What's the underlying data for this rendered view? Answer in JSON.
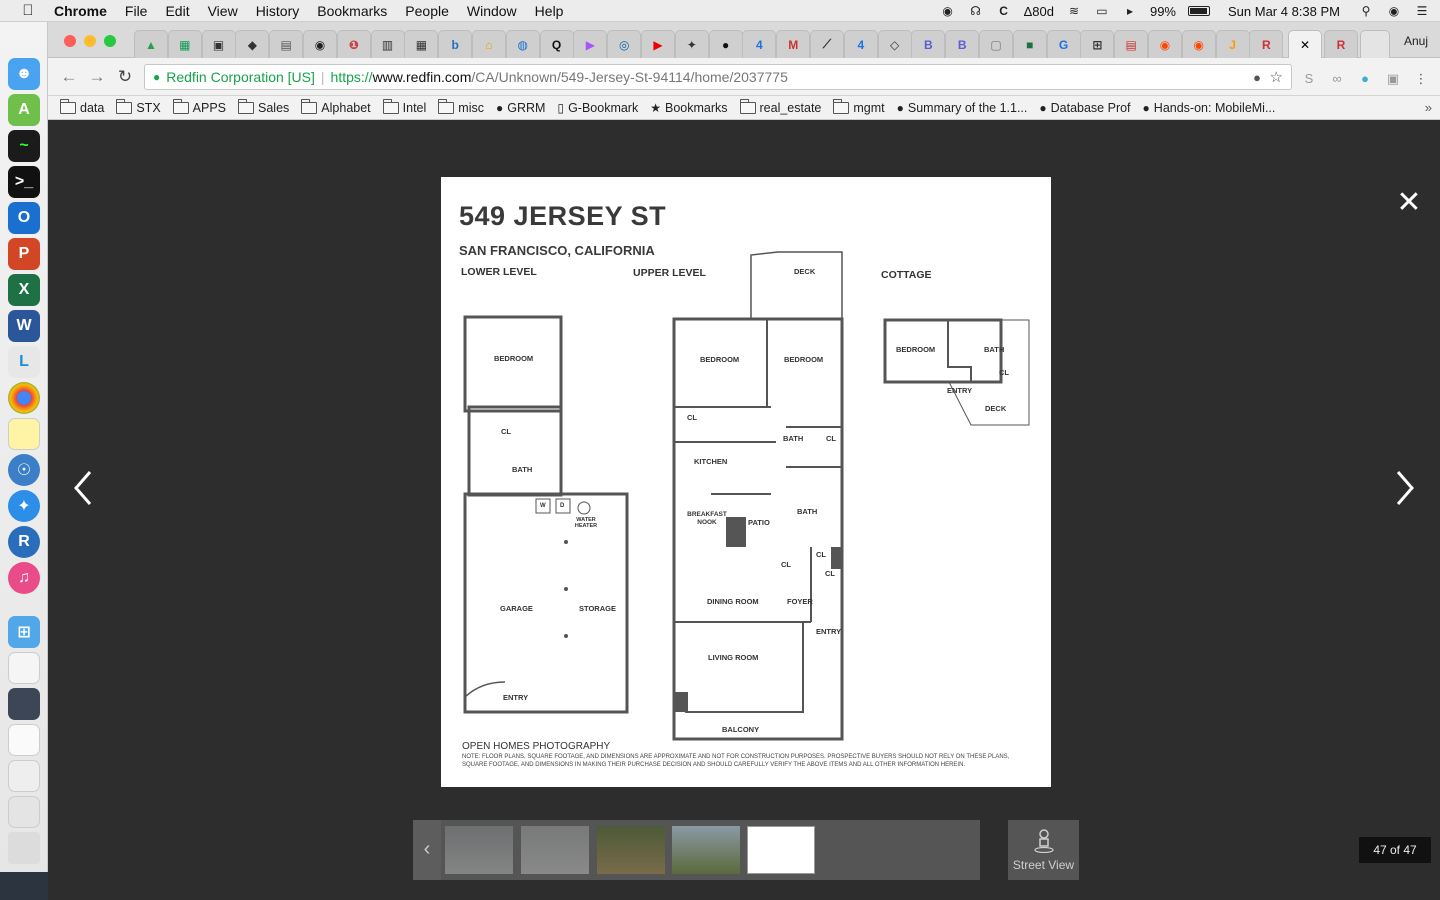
{
  "menubar": {
    "app_name": "Chrome",
    "menus": [
      "File",
      "Edit",
      "View",
      "History",
      "Bookmarks",
      "People",
      "Window",
      "Help"
    ],
    "status_counter": "80d",
    "battery": "99%",
    "clock": "Sun Mar 4  8:38 PM"
  },
  "browser": {
    "profile_name": "Anuj",
    "tabs_count_visible": 34,
    "url_ev_label": "Redfin Corporation [US]",
    "url_scheme": "https://",
    "url_host": "www.redfin.com",
    "url_path": "/CA/Unknown/549-Jersey-St-94114/home/2037775",
    "bookmarks": [
      {
        "label": "data",
        "type": "folder"
      },
      {
        "label": "STX",
        "type": "folder"
      },
      {
        "label": "APPS",
        "type": "folder"
      },
      {
        "label": "Sales",
        "type": "folder"
      },
      {
        "label": "Alphabet",
        "type": "folder"
      },
      {
        "label": "Intel",
        "type": "folder"
      },
      {
        "label": "misc",
        "type": "folder"
      },
      {
        "label": "GRRM",
        "type": "site"
      },
      {
        "label": "G-Bookmark",
        "type": "page"
      },
      {
        "label": "Bookmarks",
        "type": "star"
      },
      {
        "label": "real_estate",
        "type": "folder"
      },
      {
        "label": "mgmt",
        "type": "folder"
      },
      {
        "label": "Summary of the 1.1...",
        "type": "site"
      },
      {
        "label": "Database Prof",
        "type": "site"
      },
      {
        "label": "Hands-on: MobileMi...",
        "type": "site"
      }
    ]
  },
  "floorplan": {
    "address": "549 JERSEY ST",
    "city": "SAN FRANCISCO, CALIFORNIA",
    "sections": {
      "lower": "LOWER LEVEL",
      "upper": "UPPER LEVEL",
      "cottage": "COTTAGE"
    },
    "rooms": {
      "lower_bedroom": "BEDROOM",
      "lower_cl": "CL",
      "lower_bath": "BATH",
      "washer": "W",
      "dryer": "D",
      "water_heater": "WATER HEATER",
      "garage": "GARAGE",
      "storage": "STORAGE",
      "lower_entry": "ENTRY",
      "deck_top": "DECK",
      "bedroom_a": "BEDROOM",
      "bedroom_b": "BEDROOM",
      "upper_cl_1": "CL",
      "upper_bath_1": "BATH",
      "upper_cl_2": "CL",
      "kitchen": "KITCHEN",
      "breakfast_nook": "BREAKFAST NOOK",
      "patio": "PATIO",
      "upper_bath_2": "BATH",
      "upper_cl_3": "CL",
      "upper_cl_4": "CL",
      "upper_cl_5": "CL",
      "dining_room": "DINING ROOM",
      "foyer": "FOYER",
      "upper_entry": "ENTRY",
      "living_room": "LIVING ROOM",
      "balcony": "BALCONY",
      "cottage_bedroom": "BEDROOM",
      "cottage_bath": "BATH",
      "cottage_cl": "CL",
      "cottage_entry": "ENTRY",
      "cottage_deck": "DECK"
    },
    "photographer": "OPEN HOMES PHOTOGRAPHY",
    "note": "NOTE: FLOOR PLANS, SQUARE FOOTAGE, AND DIMENSIONS ARE APPROXIMATE AND NOT FOR CONSTRUCTION PURPOSES. PROSPECTIVE BUYERS SHOULD NOT RELY ON THESE PLANS, SQUARE FOOTAGE, AND DIMENSIONS IN MAKING THEIR PURCHASE DECISION AND SHOULD CAREFULLY VERIFY THE ABOVE ITEMS AND ALL OTHER INFORMATION HEREIN."
  },
  "viewer": {
    "counter": "47 of 47",
    "street_view_label": "Street View"
  }
}
